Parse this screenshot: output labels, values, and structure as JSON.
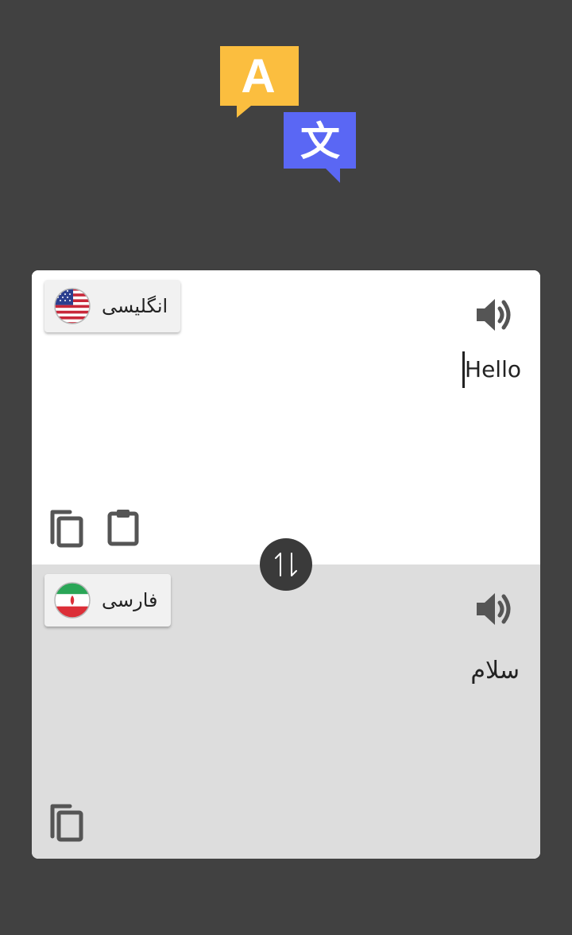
{
  "logo": {
    "letter_a": "A",
    "letter_wen": "文",
    "color_a": "#FBBE3F",
    "color_wen": "#5A67F4"
  },
  "source": {
    "language": "انگلیسی",
    "flag_icon": "us-flag-icon",
    "text": "Hello"
  },
  "target": {
    "language": "فارسی",
    "flag_icon": "iran-flag-icon",
    "text": "سلام"
  },
  "colors": {
    "background": "#414141",
    "source_panel": "#FFFFFF",
    "target_panel": "#DDDDDD",
    "icon": "#555555"
  }
}
